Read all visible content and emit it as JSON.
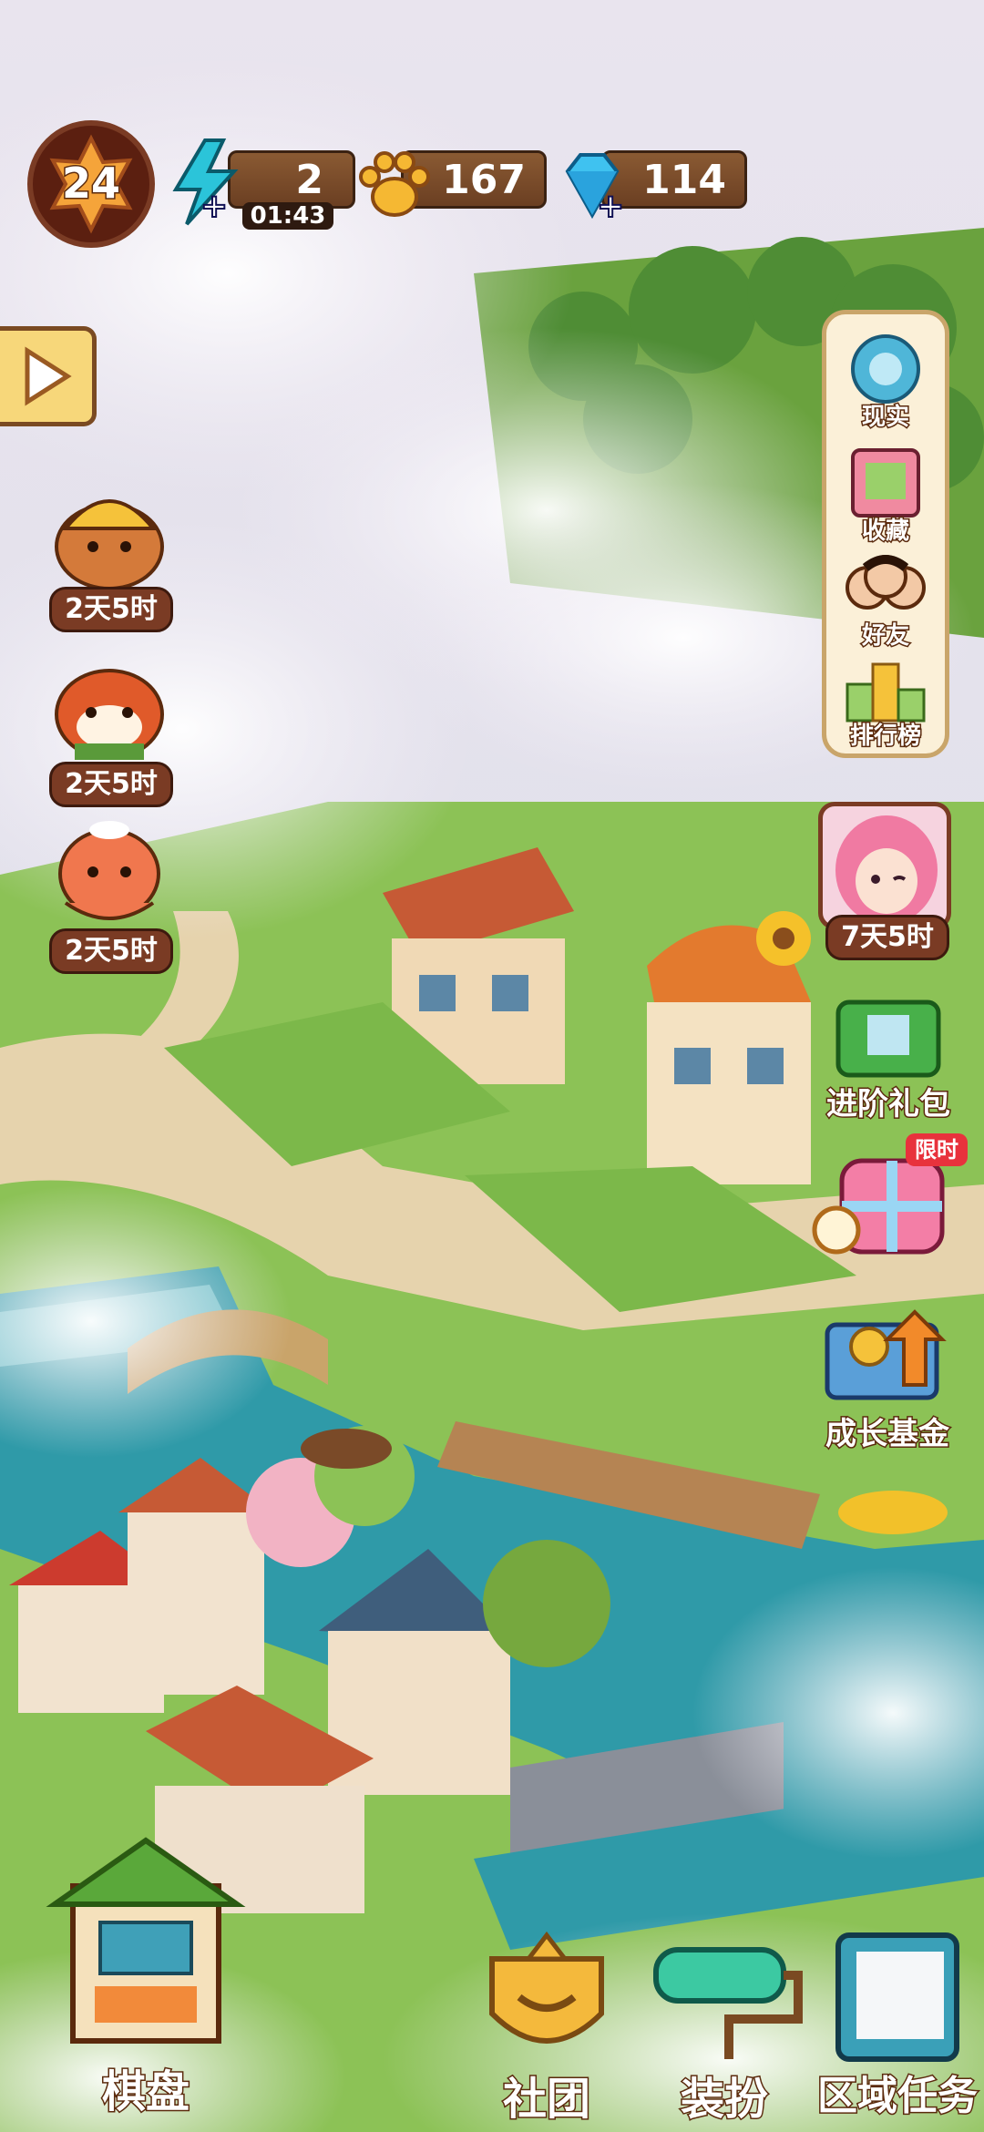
{
  "hud": {
    "level": "24",
    "energy": "2",
    "energy_timer": "01:43",
    "paws": "167",
    "gems": "114"
  },
  "side_right": {
    "reality": "现实",
    "collection": "收藏",
    "friends": "好友",
    "leaderboard": "排行榜",
    "event_timer": "7天5时",
    "advanced_pack": "进阶礼包",
    "limited_tag": "限时",
    "growth_fund": "成长基金"
  },
  "side_left": {
    "events": [
      {
        "timer": "2天5时"
      },
      {
        "timer": "2天5时"
      },
      {
        "timer": "2天5时"
      }
    ]
  },
  "bottom_nav": {
    "board": "棋盘",
    "guild": "社团",
    "dressup": "装扮",
    "area_tasks": "区域任务"
  },
  "colors": {
    "water": "#2f9aa8",
    "grass": "#7cb84a",
    "path": "#e6d3ad",
    "accent_gold": "#f4b93c"
  }
}
